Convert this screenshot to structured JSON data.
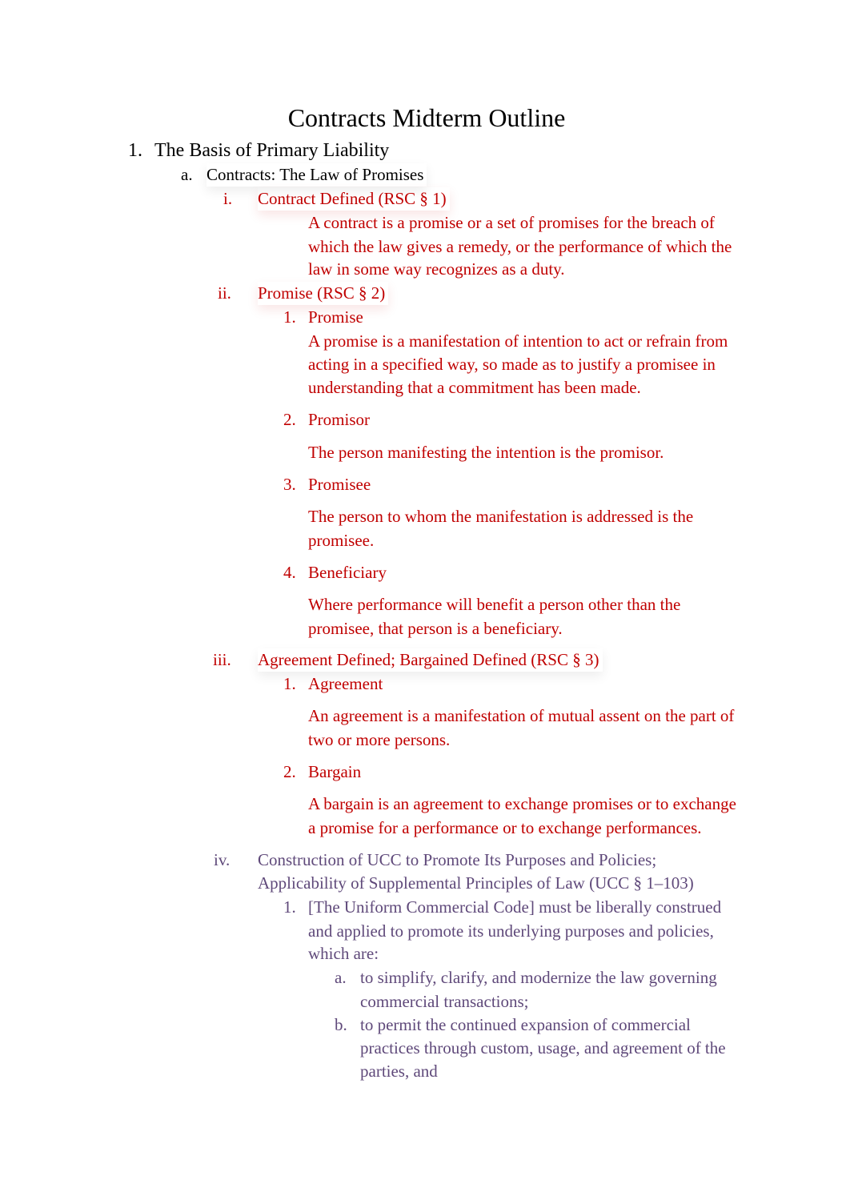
{
  "document": {
    "title": "Contracts Midterm Outline",
    "sections": [
      {
        "marker": "1.",
        "heading": "The Basis of Primary Liability",
        "subsections": [
          {
            "marker": "a.",
            "heading": "Contracts: The Law of Promises",
            "items": [
              {
                "marker": "i.",
                "heading": "Contract Defined (RSC § 1)",
                "color": "#c00000",
                "text": [
                  "A contract is a promise or a set of promises for the breach of",
                  "which the law gives a remedy, or the performance of which the",
                  "law in some way recognizes as a duty."
                ]
              },
              {
                "marker": "ii.",
                "heading": "Promise (RSC § 2)",
                "color": "#c00000",
                "points": [
                  {
                    "marker": "1.",
                    "term": "Promise",
                    "text": [
                      "A promise is a manifestation of intention to act or refrain from",
                      "acting in a specified way, so made as to justify a promisee in",
                      "understanding that a commitment has been made."
                    ]
                  },
                  {
                    "marker": "2.",
                    "term": "Promisor",
                    "text": [
                      "The person manifesting the intention is the promisor."
                    ]
                  },
                  {
                    "marker": "3.",
                    "term": "Promisee",
                    "text": [
                      "The person to whom the manifestation is addressed is the",
                      "promisee."
                    ]
                  },
                  {
                    "marker": "4.",
                    "term": "Beneficiary",
                    "text": [
                      "Where performance will benefit a person other than the",
                      "promisee, that person is a beneficiary."
                    ]
                  }
                ]
              },
              {
                "marker": "iii.",
                "heading": "Agreement Defined; Bargained Defined (RSC § 3)",
                "color": "#c00000",
                "points": [
                  {
                    "marker": "1.",
                    "term": "Agreement",
                    "text": [
                      "An agreement is a manifestation of mutual assent on the part of",
                      "two or more persons."
                    ]
                  },
                  {
                    "marker": "2.",
                    "term": "Bargain",
                    "text": [
                      "A bargain is an agreement to exchange promises or to exchange",
                      "a promise for a performance or to exchange performances."
                    ]
                  }
                ]
              },
              {
                "marker": "iv.",
                "heading": [
                  "Construction of UCC to Promote Its Purposes and Policies;",
                  "Applicability of Supplemental Principles of Law (UCC § 1–103)"
                ],
                "color": "#5f497a",
                "points": [
                  {
                    "marker": "1.",
                    "text": [
                      "[The Uniform Commercial Code] must be liberally construed",
                      "and applied to promote its underlying purposes and policies,",
                      "which are:"
                    ],
                    "subpoints": [
                      {
                        "marker": "a.",
                        "text": [
                          "to simplify, clarify, and modernize the law governing",
                          "commercial transactions;"
                        ]
                      },
                      {
                        "marker": "b.",
                        "text": [
                          "to permit the continued expansion of commercial",
                          "practices through custom, usage, and agreement of the",
                          "parties, and"
                        ]
                      }
                    ]
                  }
                ]
              }
            ]
          }
        ]
      }
    ]
  }
}
